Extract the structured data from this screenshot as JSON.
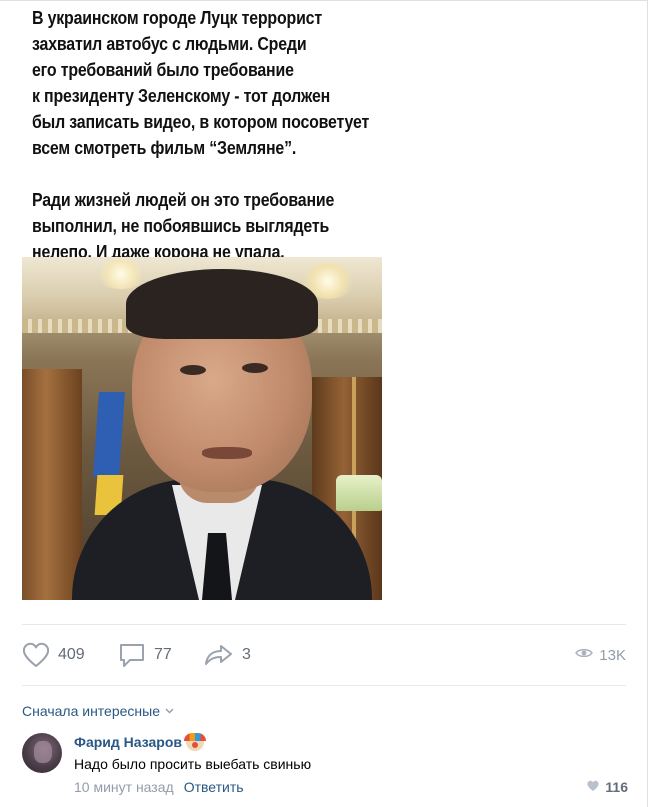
{
  "post": {
    "meme_lines_1": [
      "В украинском городе Луцк террорист",
      "захватил автобус с людьми. Среди",
      "его требований было требование",
      "к президенту Зеленскому - тот должен",
      "был записать видео, в котором посоветует",
      "всем смотреть фильм “Земляне”."
    ],
    "meme_lines_2": [
      "Ради жизней людей он это требование",
      "выполнил, не побоявшись выглядеть",
      "нелепо. И даже корона не упала."
    ]
  },
  "actions": {
    "likes": "409",
    "comments": "77",
    "shares": "3",
    "views": "13K"
  },
  "comments_sort": {
    "label": "Сначала интересные"
  },
  "comment": {
    "author": "Фарид Назаров",
    "text": "Надо было просить выебать свинью",
    "time": "10 минут назад",
    "reply_label": "Ответить",
    "likes": "116"
  },
  "colors": {
    "link": "#2a5885",
    "muted": "#939cab",
    "action": "#626d7a",
    "divider": "#e7e8ec"
  }
}
